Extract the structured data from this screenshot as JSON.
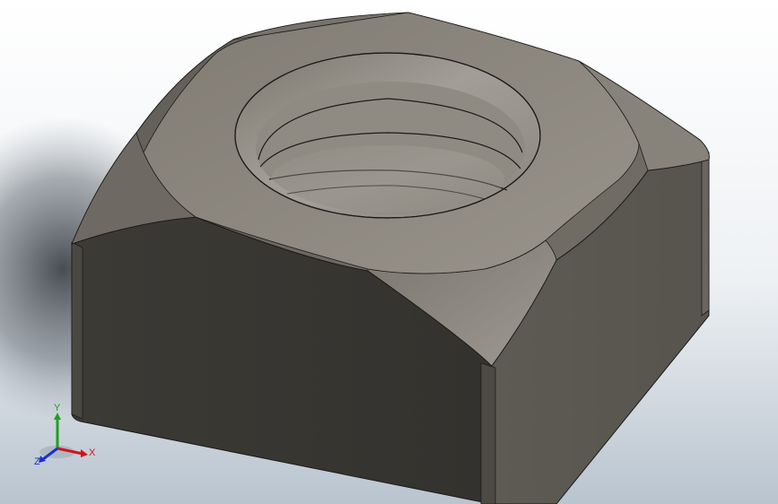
{
  "viewport": {
    "model": "square-nut",
    "background_top": "#ffffff",
    "background_bottom": "#b9c4cf"
  },
  "triad": {
    "x_label": "X",
    "y_label": "Y",
    "z_label": "Z",
    "x_color": "#d0151c",
    "y_color": "#1ea01e",
    "z_color": "#1b2fd0"
  }
}
